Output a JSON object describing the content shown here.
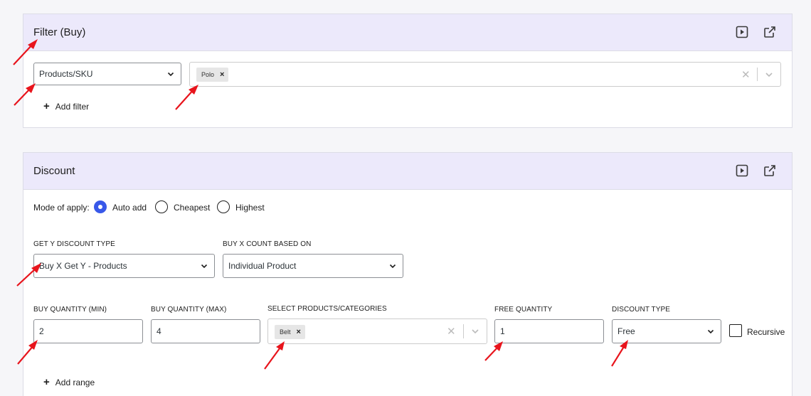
{
  "filter_panel": {
    "title": "Filter (Buy)",
    "filter_type": "Products/SKU",
    "selected_tags": [
      "Polo"
    ],
    "add_filter_label": "Add filter"
  },
  "discount_panel": {
    "title": "Discount",
    "mode_label": "Mode of apply:",
    "mode_options": [
      {
        "label": "Auto add",
        "selected": true
      },
      {
        "label": "Cheapest",
        "selected": false
      },
      {
        "label": "Highest",
        "selected": false
      }
    ],
    "get_y_type": {
      "label": "GET Y DISCOUNT TYPE",
      "value": "Buy X Get Y - Products"
    },
    "buy_count_based": {
      "label": "BUY X COUNT BASED ON",
      "value": "Individual Product"
    },
    "range": {
      "buy_min": {
        "label": "BUY QUANTITY (MIN)",
        "value": "2"
      },
      "buy_max": {
        "label": "BUY QUANTITY (MAX)",
        "value": "4"
      },
      "products": {
        "label": "SELECT PRODUCTS/CATEGORIES",
        "tags": [
          "Belt"
        ]
      },
      "free_qty": {
        "label": "FREE QUANTITY",
        "value": "1"
      },
      "discount_type": {
        "label": "DISCOUNT TYPE",
        "value": "Free"
      },
      "recursive": {
        "label": "Recursive",
        "checked": false
      }
    },
    "add_range_label": "Add range"
  },
  "icons": {
    "preview": "play-square-icon",
    "open": "external-link-icon",
    "chevron": "chevron-down-icon",
    "clear": "close-icon",
    "add": "plus-icon"
  },
  "colors": {
    "header_bg": "#ece9fb",
    "accent": "#3858e9",
    "annotation_arrow": "#e8141c"
  }
}
